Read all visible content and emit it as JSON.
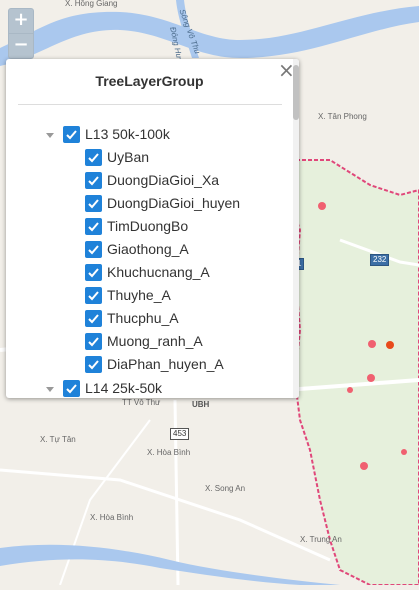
{
  "map": {
    "labels": {
      "hong_giang": "X. Hồng Giang",
      "song_vo_thu": "Sông Vô Thu",
      "dong_hung": "Đông Hưng",
      "tan_phong": "X. Tân Phong",
      "vo_thu": "TT Vô Thư",
      "ubh": "UBH",
      "tu_tan": "X. Tự Tân",
      "hoa_binh_1": "X. Hòa Bình",
      "song_an": "X. Song An",
      "hoa_binh_2": "X. Hòa Bình",
      "trung_an": "X. Trung An"
    },
    "shields": {
      "r232": "232",
      "r453": "453",
      "r1": "1"
    },
    "colors": {
      "river": "#aac8ee",
      "district_fill": "#e6f0dc",
      "district_border": "#e0477a",
      "point": "#f06070",
      "point_active": "#e84a1b",
      "road": "#ffffff"
    }
  },
  "controls": {
    "zoom_in": "+",
    "zoom_out": "−"
  },
  "panel": {
    "title": "TreeLayerGroup",
    "close": "×",
    "groups": [
      {
        "label": "L13 50k-100k",
        "checked": true,
        "expanded": true,
        "children": [
          {
            "label": "UyBan",
            "checked": true
          },
          {
            "label": "DuongDiaGioi_Xa",
            "checked": true
          },
          {
            "label": "DuongDiaGioi_huyen",
            "checked": true
          },
          {
            "label": "TimDuongBo",
            "checked": true
          },
          {
            "label": "Giaothong_A",
            "checked": true
          },
          {
            "label": "Khuchucnang_A",
            "checked": true
          },
          {
            "label": "Thuyhe_A",
            "checked": true
          },
          {
            "label": "Thucphu_A",
            "checked": true
          },
          {
            "label": "Muong_ranh_A",
            "checked": true
          },
          {
            "label": "DiaPhan_huyen_A",
            "checked": true
          }
        ]
      },
      {
        "label": "L14 25k-50k",
        "checked": true,
        "expanded": true
      }
    ]
  }
}
